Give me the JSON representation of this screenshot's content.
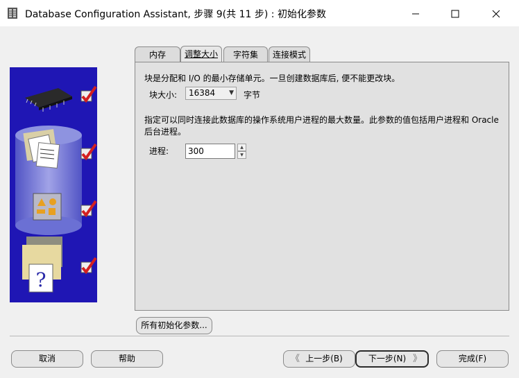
{
  "window": {
    "title": "Database Configuration Assistant, 步骤 9(共 11 步) : 初始化参数",
    "minimize": "—",
    "maximize": "☐",
    "close": "✕"
  },
  "tabs": [
    {
      "label": "内存"
    },
    {
      "label": "调整大小"
    },
    {
      "label": "字符集"
    },
    {
      "label": "连接模式"
    }
  ],
  "sizing": {
    "block_desc": "块是分配和 I/O 的最小存储单元。一旦创建数据库后, 便不能更改块。",
    "block_label": "块大小:",
    "block_value": "16384",
    "block_unit": "字节",
    "process_desc": "指定可以同时连接此数据库的操作系统用户进程的最大数量。此参数的值包括用户进程和 Oracle 后台进程。",
    "process_label": "进程:",
    "process_value": "300"
  },
  "buttons": {
    "all_params": "所有初始化参数...",
    "cancel": "取消",
    "help": "帮助",
    "prev": "上一步(B)",
    "next": "下一步(N)",
    "finish": "完成(F)"
  },
  "colors": {
    "wizard_panel": "#1f16b4",
    "check": "#d42020"
  }
}
